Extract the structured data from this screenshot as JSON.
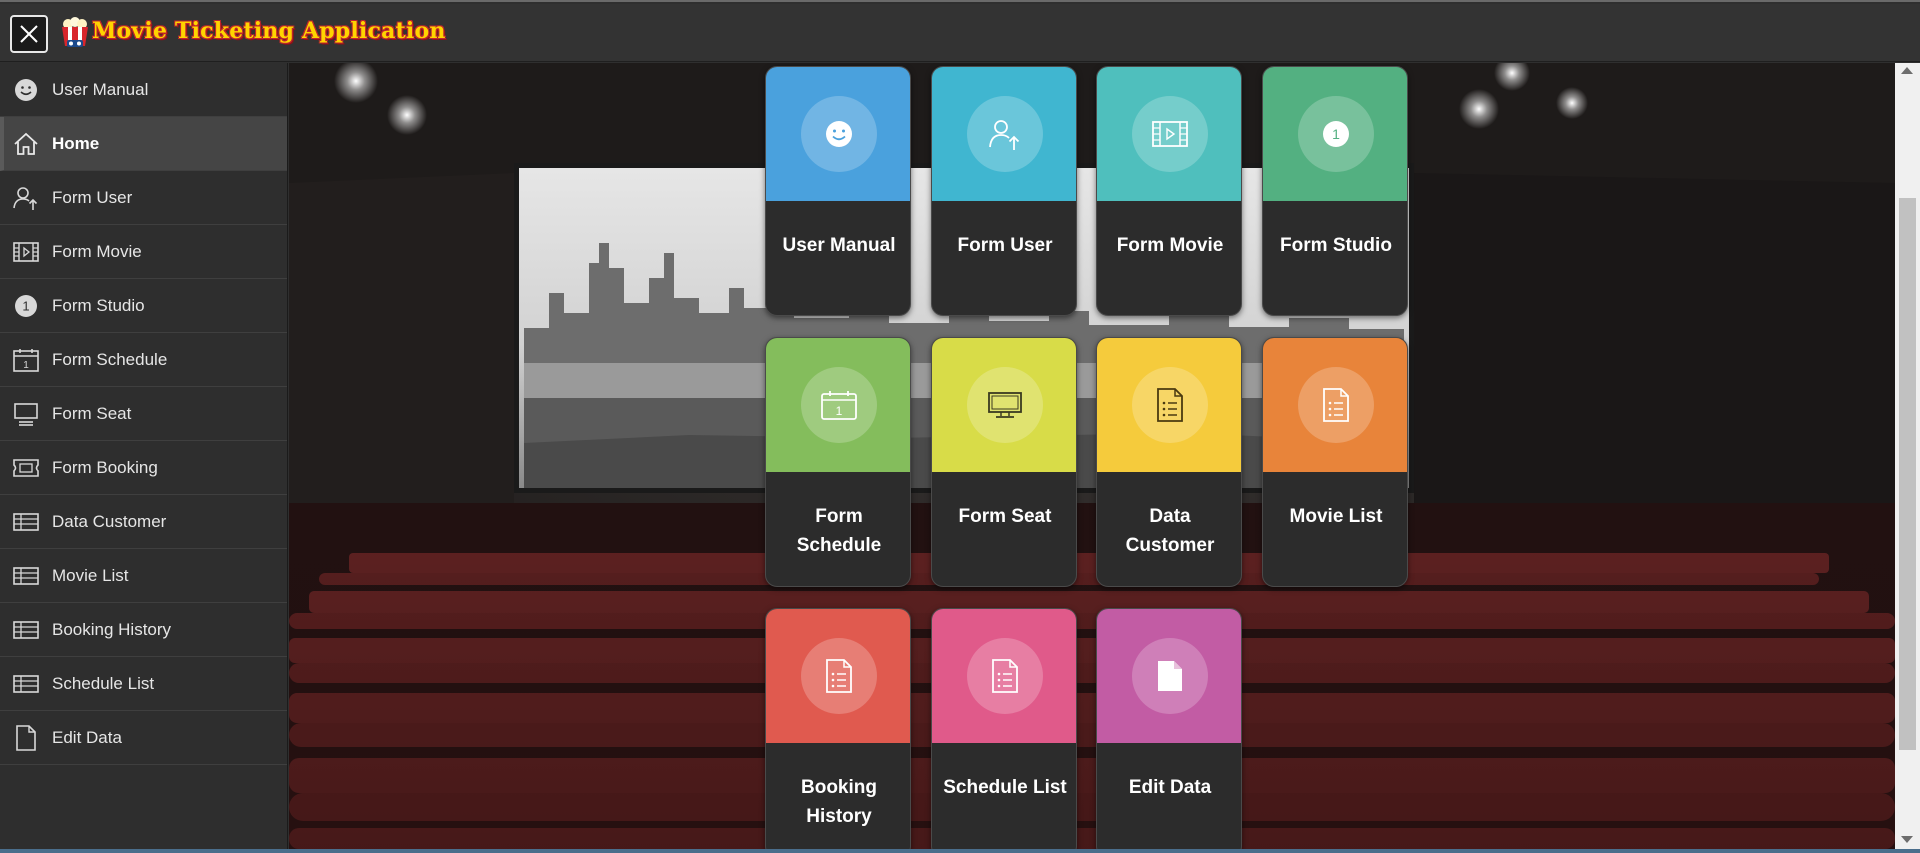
{
  "app": {
    "title": "Movie Ticketing Application"
  },
  "sidebar": {
    "items": [
      {
        "label": "User Manual",
        "icon": "smiley-icon"
      },
      {
        "label": "Home",
        "icon": "home-icon",
        "active": true
      },
      {
        "label": "Form User",
        "icon": "user-upload-icon"
      },
      {
        "label": "Form Movie",
        "icon": "film-icon"
      },
      {
        "label": "Form Studio",
        "icon": "number-one-icon"
      },
      {
        "label": "Form Schedule",
        "icon": "calendar-icon"
      },
      {
        "label": "Form Seat",
        "icon": "monitor-icon"
      },
      {
        "label": "Form Booking",
        "icon": "ticket-icon"
      },
      {
        "label": "Data Customer",
        "icon": "table-icon"
      },
      {
        "label": "Movie List",
        "icon": "table-icon"
      },
      {
        "label": "Booking History",
        "icon": "table-icon"
      },
      {
        "label": "Schedule List",
        "icon": "table-icon"
      },
      {
        "label": "Edit Data",
        "icon": "document-icon"
      }
    ]
  },
  "tiles": [
    {
      "label": "User Manual",
      "color": "#4aa1dd",
      "icon": "smiley-icon"
    },
    {
      "label": "Form User",
      "color": "#40b6d0",
      "icon": "user-upload-icon"
    },
    {
      "label": "Form Movie",
      "color": "#4fbfbd",
      "icon": "film-icon"
    },
    {
      "label": "Form Studio",
      "color": "#53b081",
      "icon": "number-one-icon"
    },
    {
      "label": "Form Schedule",
      "color": "#84bd5c",
      "icon": "calendar-icon"
    },
    {
      "label": "Form Seat",
      "color": "#d8dc48",
      "icon": "monitor-icon"
    },
    {
      "label": "Data Customer",
      "color": "#f5cb3c",
      "icon": "list-document-icon"
    },
    {
      "label": "Movie List",
      "color": "#e8843a",
      "icon": "list-document-icon"
    },
    {
      "label": "Booking History",
      "color": "#e05a4f",
      "icon": "list-document-icon"
    },
    {
      "label": "Schedule List",
      "color": "#e05a8a",
      "icon": "list-document-icon"
    },
    {
      "label": "Edit Data",
      "color": "#c25ca4",
      "icon": "document-icon"
    }
  ],
  "colors": {
    "title_text": "#ffd400",
    "title_outline": "#c0262c",
    "sidebar_bg": "#2e2e2e",
    "tile_bottom": "#2c2c2c"
  }
}
